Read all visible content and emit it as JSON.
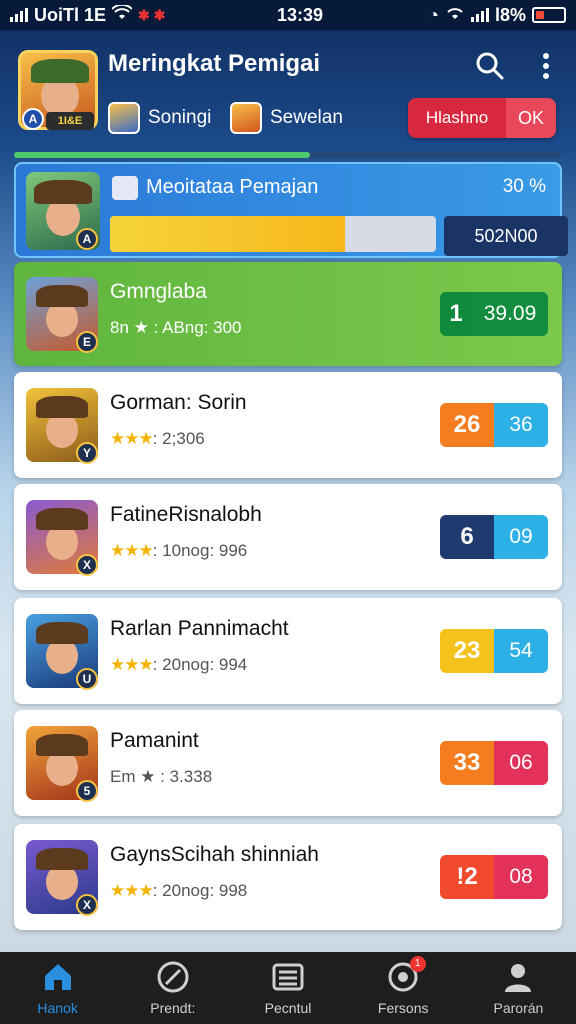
{
  "status_bar": {
    "carrier": "UoiTl 1E",
    "time": "13:39",
    "battery": "l8%"
  },
  "header": {
    "title": "Meringkat Pemigai",
    "tabs": [
      {
        "label": "Soningi"
      },
      {
        "label": "Sewelan"
      }
    ],
    "hero_badge": "A",
    "hero_tag": "1I&E",
    "action": {
      "label": "Hlashno",
      "value": "OK"
    },
    "top_progress": 0.54
  },
  "featured": {
    "title": "Meoitataa Pemajan",
    "percent": "30 %",
    "progress": 0.72,
    "score": "502N00",
    "badge": "A"
  },
  "items": [
    {
      "name": "Gmnglaba",
      "meta": "8n ★ : ABng: 300",
      "pill_left": "1",
      "pill_right": "39.09",
      "left_color": "#0e8a3a",
      "right_color": "#128d3d",
      "highlight": true,
      "badge": "E"
    },
    {
      "name": "Gorman: Sorin",
      "meta_stars": "★★★",
      "meta": ": 2;306",
      "pill_left": "26",
      "pill_right": "36",
      "left_color": "#f57c1f",
      "right_color": "#2db0e6",
      "badge": "Y"
    },
    {
      "name": "FatineRisnalobh",
      "meta_stars": "★★★",
      "meta": ": 10nog: 996",
      "pill_left": "6",
      "pill_right": "09",
      "left_color": "#1e3a6e",
      "right_color": "#2db0e6",
      "badge": "X"
    },
    {
      "name": "Rarlan Pannimacht",
      "meta_stars": "★★★",
      "meta": ": 20nog: 994",
      "pill_left": "23",
      "pill_right": "54",
      "left_color": "#f4c21b",
      "right_color": "#2db0e6",
      "badge": "U"
    },
    {
      "name": "Pamanint",
      "meta": "Em ★ : 3.338",
      "pill_left": "33",
      "pill_right": "06",
      "left_color": "#f57c1f",
      "right_color": "#e3325a",
      "badge": "5"
    },
    {
      "name": "GaynsScihah shinniah",
      "meta_stars": "★★★",
      "meta": ": 20nog: 998",
      "pill_left": "!2",
      "pill_right": "08",
      "left_color": "#ef4a2c",
      "right_color": "#e3325a",
      "badge": "X"
    }
  ],
  "bottom_nav": [
    {
      "label": "Hanok",
      "icon": "home-icon",
      "active": true
    },
    {
      "label": "Prendt:",
      "icon": "compass-icon"
    },
    {
      "label": "Pecntul",
      "icon": "list-icon"
    },
    {
      "label": "Fersons",
      "icon": "settings-icon",
      "badge": "1"
    },
    {
      "label": "Parorán",
      "icon": "profile-icon"
    }
  ],
  "colors": {
    "accent": "#2b8fe0",
    "highlight_green": "#6abf45"
  }
}
